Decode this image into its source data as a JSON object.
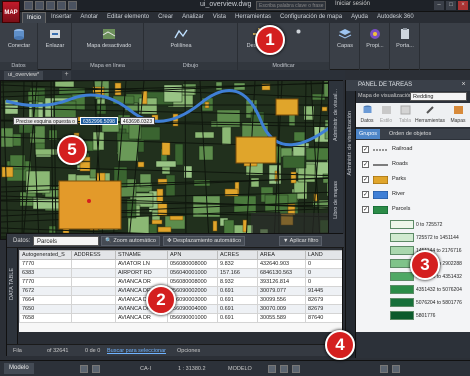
{
  "titlebar": {
    "app_button": "MAP",
    "document": "ui_overview.dwg",
    "search_placeholder": "Escriba palabra clave o frase",
    "signin": "Iniciar sesión"
  },
  "ribbon_tabs": [
    "Inicio",
    "Insertar",
    "Anotar",
    "Editar elemento",
    "Crear",
    "Analizar",
    "Vista",
    "Herramientas",
    "Configuración de mapa",
    "Ayuda",
    "Autodesk 360"
  ],
  "ribbon": {
    "conectar": "Conectar",
    "enlazar": "Enlazar",
    "mapa_desactivado": "Mapa desactivado",
    "polilinea": "Polilínea",
    "desplazar": "Desplazar",
    "capas": "Capas",
    "propiedades": "Propi...",
    "portapapeles": "Porta...",
    "groups": [
      "Datos",
      "Mapa en línea",
      "Dibujo",
      "Modificar"
    ]
  },
  "doc_tab": "ui_overview*",
  "coord_tooltip": {
    "label": "Precise esquina opuesta o",
    "x": "6352996.5098",
    "y": "463698.0323"
  },
  "map_side_tabs": [
    "Administr. de visual...",
    "Libro de mapas"
  ],
  "data_panel": {
    "datos_label": "Datos:",
    "datos_value": "Parcels",
    "zoom_auto": "Zoom automático",
    "desplaz_auto": "Desplazamiento automático",
    "apply_filter": "Aplicar filtro",
    "columns": [
      "Autogenerated_S",
      "ADDRESS",
      "STNAME",
      "APN",
      "ACRES",
      "AREA",
      "LAND"
    ],
    "rows": [
      [
        "7770",
        "",
        "AVIATOR LN",
        "056080008000",
        "9.832",
        "432640.903",
        "0"
      ],
      [
        "6383",
        "",
        "AIRPORT RD",
        "056040001000",
        "157.166",
        "6846130.563",
        "0"
      ],
      [
        "7770",
        "",
        "AVIANCA DR",
        "056080008000",
        "8.932",
        "393126.814",
        "0"
      ],
      [
        "7672",
        "",
        "AVIANCA DR",
        "056090002000",
        "0.691",
        "30079.077",
        "91445"
      ],
      [
        "7664",
        "",
        "AVIANCA DR",
        "056090003000",
        "0.691",
        "30099.556",
        "82679"
      ],
      [
        "7650",
        "",
        "AVIANCA DR",
        "056090004000",
        "0.691",
        "30070.009",
        "82679"
      ],
      [
        "7658",
        "",
        "AVIANCA DR",
        "056090001000",
        "0.691",
        "30055.589",
        "87640"
      ]
    ],
    "status": {
      "row_label": "Fila",
      "of_count": "of 32641",
      "sel_count": "0 de 0",
      "select_link": "Buscar para seleccionar",
      "options": "Opciones"
    },
    "side_tab": "DATA TABLE"
  },
  "task_pane": {
    "title": "PANEL DE TAREAS",
    "visualization_label": "Mapa de visualización",
    "visualization_value": "Redding",
    "tools": [
      "Datos",
      "Estilo",
      "Tabla",
      "Herramientas",
      "Mapas"
    ],
    "subtabs": [
      "Grupos",
      "Orden de objetos"
    ],
    "layers": [
      {
        "name": "Railroad",
        "checked": true
      },
      {
        "name": "Roads",
        "checked": true
      },
      {
        "name": "Parks",
        "checked": true
      },
      {
        "name": "River",
        "checked": true
      },
      {
        "name": "Parcels",
        "checked": true
      }
    ],
    "legend": [
      "0 to 725572",
      "725572 to 1451144",
      "1451144 to 2176716",
      "2176716 to 2902288",
      "3625860 to 4351432",
      "4351432 to 5076204",
      "5076204 to 5801776",
      "5801776"
    ],
    "legend_colors": [
      "#eef7ea",
      "#d0ead0",
      "#a9d7ae",
      "#7fc38a",
      "#4fa865",
      "#2b8b47",
      "#17703a",
      "#0b5a2c"
    ],
    "side_tab": "Administr. de visualización"
  },
  "statusbar": {
    "model_tab": "Modelo",
    "coords": "1 : 31380.2",
    "modelo": "MODELO",
    "ca_label": "CA-I"
  },
  "callouts": [
    "1",
    "2",
    "3",
    "4",
    "5"
  ],
  "colors": {
    "ribbon_bg": "#3a3f47",
    "callout": "#d41f1f",
    "parks": "#e0a52b",
    "river": "#3f7fd6",
    "parcels": "#2b8b47"
  }
}
